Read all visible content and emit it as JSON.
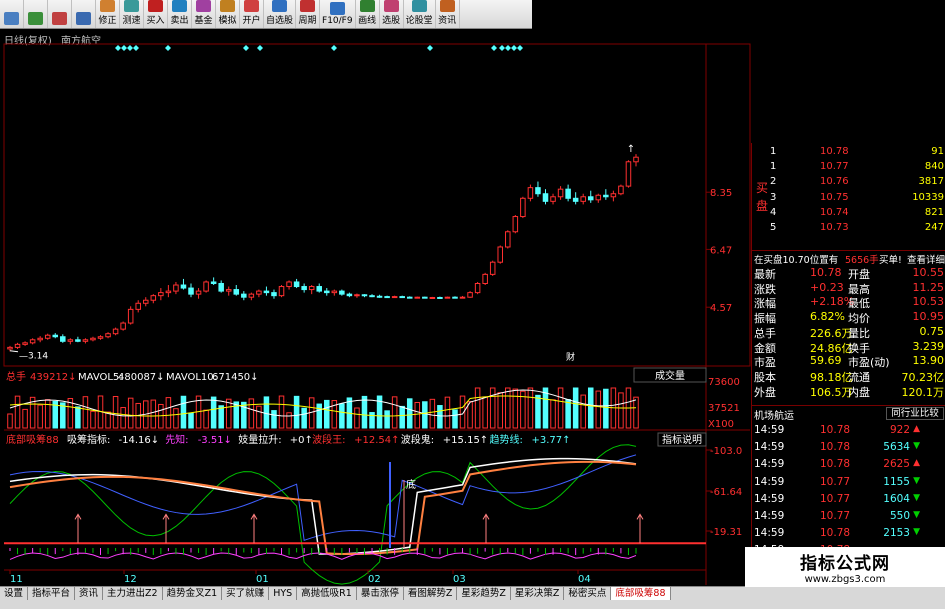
{
  "toolbar": {
    "buttons": [
      {
        "label": "",
        "icon": "app-icon",
        "color": "#4a7fc1"
      },
      {
        "label": "",
        "icon": "grid-icon",
        "color": "#3a8f3a"
      },
      {
        "label": "",
        "icon": "bars-icon",
        "color": "#c04040"
      },
      {
        "label": "",
        "icon": "back-icon",
        "color": "#3a6ab0"
      },
      {
        "label": "修正",
        "icon": "edit-icon",
        "color": "#d08030"
      },
      {
        "label": "测速",
        "icon": "speed-icon",
        "color": "#3a9a9a"
      },
      {
        "label": "买入",
        "icon": "buy-icon",
        "color": "#c02020"
      },
      {
        "label": "卖出",
        "icon": "sell-icon",
        "color": "#2080c0"
      },
      {
        "label": "基金",
        "icon": "fund-icon",
        "color": "#a040a0"
      },
      {
        "label": "模拟",
        "icon": "sim-icon",
        "color": "#c08020"
      },
      {
        "label": "开户",
        "icon": "account-icon",
        "color": "#d04040"
      },
      {
        "label": "自选股",
        "icon": "watchlist-icon",
        "color": "#3070c0"
      },
      {
        "label": "周期",
        "icon": "period-icon",
        "color": "#c03030"
      },
      {
        "label": "F10/F9",
        "icon": "f10-icon",
        "color": "#3070c0"
      },
      {
        "label": "画线",
        "icon": "draw-icon",
        "color": "#308030"
      },
      {
        "label": "选股",
        "icon": "screen-icon",
        "color": "#c04070"
      },
      {
        "label": "论股堂",
        "icon": "forum-icon",
        "color": "#3090a0"
      },
      {
        "label": "资讯",
        "icon": "news-icon",
        "color": "#c06020"
      }
    ]
  },
  "chart": {
    "period": "日线(复权)",
    "name": "南方航空",
    "price_ticks": [
      "8.35",
      "6.47",
      "4.57"
    ],
    "low_label": "3.14",
    "fin_marker": "财",
    "candles": [
      [
        3.2,
        3.3,
        3.12,
        3.25
      ],
      [
        3.25,
        3.4,
        3.2,
        3.35
      ],
      [
        3.35,
        3.45,
        3.3,
        3.4
      ],
      [
        3.4,
        3.55,
        3.35,
        3.5
      ],
      [
        3.5,
        3.62,
        3.42,
        3.55
      ],
      [
        3.55,
        3.7,
        3.5,
        3.65
      ],
      [
        3.65,
        3.72,
        3.55,
        3.6
      ],
      [
        3.6,
        3.68,
        3.4,
        3.45
      ],
      [
        3.45,
        3.55,
        3.35,
        3.5
      ],
      [
        3.5,
        3.6,
        3.42,
        3.45
      ],
      [
        3.45,
        3.55,
        3.38,
        3.5
      ],
      [
        3.5,
        3.6,
        3.45,
        3.55
      ],
      [
        3.55,
        3.65,
        3.5,
        3.6
      ],
      [
        3.6,
        3.75,
        3.55,
        3.7
      ],
      [
        3.7,
        3.9,
        3.65,
        3.85
      ],
      [
        3.85,
        4.1,
        3.8,
        4.05
      ],
      [
        4.05,
        4.6,
        4.0,
        4.5
      ],
      [
        4.5,
        4.8,
        4.4,
        4.7
      ],
      [
        4.7,
        4.9,
        4.6,
        4.8
      ],
      [
        4.8,
        5.0,
        4.7,
        4.95
      ],
      [
        4.95,
        5.2,
        4.8,
        5.05
      ],
      [
        5.05,
        5.3,
        4.9,
        5.1
      ],
      [
        5.1,
        5.4,
        5.0,
        5.3
      ],
      [
        5.3,
        5.5,
        5.15,
        5.2
      ],
      [
        5.2,
        5.35,
        4.9,
        5.0
      ],
      [
        5.0,
        5.2,
        4.85,
        5.1
      ],
      [
        5.1,
        5.45,
        5.05,
        5.4
      ],
      [
        5.4,
        5.55,
        5.3,
        5.35
      ],
      [
        5.35,
        5.45,
        5.05,
        5.1
      ],
      [
        5.1,
        5.25,
        4.95,
        5.15
      ],
      [
        5.15,
        5.3,
        4.95,
        5.0
      ],
      [
        5.0,
        5.1,
        4.8,
        4.9
      ],
      [
        4.9,
        5.05,
        4.8,
        5.0
      ],
      [
        5.0,
        5.15,
        4.9,
        5.1
      ],
      [
        5.1,
        5.25,
        4.95,
        5.05
      ],
      [
        5.05,
        5.15,
        4.85,
        4.95
      ],
      [
        4.95,
        5.3,
        4.9,
        5.25
      ],
      [
        5.25,
        5.45,
        5.15,
        5.4
      ],
      [
        5.4,
        5.5,
        5.2,
        5.25
      ],
      [
        5.25,
        5.35,
        5.05,
        5.15
      ],
      [
        5.15,
        5.3,
        5.0,
        5.25
      ],
      [
        5.25,
        5.35,
        5.05,
        5.1
      ],
      [
        5.1,
        5.2,
        4.95,
        5.05
      ],
      [
        5.05,
        5.15,
        4.95,
        5.1
      ],
      [
        5.1,
        5.15,
        4.95,
        5.0
      ],
      [
        5.0,
        5.05,
        4.9,
        4.95
      ],
      [
        4.95,
        5.02,
        4.88,
        4.98
      ],
      [
        4.98,
        5.0,
        4.9,
        4.95
      ],
      [
        4.95,
        5.0,
        4.9,
        4.93
      ],
      [
        4.93,
        4.98,
        4.88,
        4.92
      ],
      [
        4.92,
        4.95,
        4.88,
        4.9
      ],
      [
        4.9,
        4.95,
        4.88,
        4.92
      ],
      [
        4.92,
        4.95,
        4.88,
        4.9
      ],
      [
        4.9,
        4.93,
        4.87,
        4.89
      ],
      [
        4.89,
        4.92,
        4.86,
        4.9
      ],
      [
        4.9,
        4.92,
        4.86,
        4.88
      ],
      [
        4.88,
        4.91,
        4.86,
        4.89
      ],
      [
        4.89,
        4.92,
        4.86,
        4.88
      ],
      [
        4.88,
        4.92,
        4.86,
        4.9
      ],
      [
        4.9,
        4.93,
        4.87,
        4.89
      ],
      [
        4.89,
        4.94,
        4.86,
        4.9
      ],
      [
        4.9,
        5.1,
        4.88,
        5.05
      ],
      [
        5.05,
        5.4,
        5.0,
        5.35
      ],
      [
        5.35,
        5.7,
        5.3,
        5.65
      ],
      [
        5.65,
        6.1,
        5.6,
        6.05
      ],
      [
        6.05,
        6.6,
        6.0,
        6.55
      ],
      [
        6.55,
        7.1,
        6.5,
        7.05
      ],
      [
        7.05,
        7.6,
        7.0,
        7.55
      ],
      [
        7.55,
        8.2,
        7.5,
        8.15
      ],
      [
        8.15,
        8.6,
        8.05,
        8.5
      ],
      [
        8.5,
        8.7,
        8.2,
        8.3
      ],
      [
        8.3,
        8.45,
        7.95,
        8.05
      ],
      [
        8.05,
        8.3,
        7.95,
        8.2
      ],
      [
        8.2,
        8.55,
        8.1,
        8.45
      ],
      [
        8.45,
        8.6,
        8.05,
        8.15
      ],
      [
        8.15,
        8.35,
        7.95,
        8.05
      ],
      [
        8.05,
        8.3,
        7.95,
        8.2
      ],
      [
        8.2,
        8.4,
        8.0,
        8.1
      ],
      [
        8.1,
        8.3,
        8.0,
        8.25
      ],
      [
        8.25,
        8.45,
        8.1,
        8.2
      ],
      [
        8.2,
        8.4,
        8.05,
        8.3
      ],
      [
        8.3,
        8.6,
        8.25,
        8.55
      ],
      [
        8.55,
        9.4,
        8.5,
        9.35
      ],
      [
        9.35,
        9.6,
        9.2,
        9.5
      ]
    ]
  },
  "volume": {
    "label": "总手",
    "value": "439212",
    "ma5_label": "MAVOL5:",
    "ma5_value": "480087",
    "ma10_label": "MAVOL10:",
    "ma10_value": "671450",
    "dropdown": "成交量",
    "axis_ticks": [
      "73600",
      "37521",
      "X100"
    ]
  },
  "indicator": {
    "name": "底部吸筹88",
    "label1": "吸筹指标:",
    "value1": "-14.16",
    "label2": "先知:",
    "value2": "-3.51",
    "label3": "妓量拉升:",
    "value3": "+0",
    "label4": "波段王:",
    "value4": "+12.54",
    "label5": "波段鬼:",
    "value5": "+15.15",
    "label6": "趋势线:",
    "value6": "+3.77",
    "help_button": "指标说明",
    "axis_ticks": [
      "103.0",
      "61.64",
      "19.31"
    ],
    "marker_text": "底",
    "date_ticks": [
      "11",
      "12",
      "01",
      "02",
      "03",
      "04"
    ]
  },
  "orderbook": {
    "side_label_top": "买",
    "side_label_bottom": "盘",
    "levels": [
      {
        "idx": "1",
        "price": "10.78",
        "vol": "91"
      },
      {
        "idx": "1",
        "price": "10.77",
        "vol": "840"
      },
      {
        "idx": "2",
        "price": "10.76",
        "vol": "3817"
      },
      {
        "idx": "3",
        "price": "10.75",
        "vol": "10339"
      },
      {
        "idx": "4",
        "price": "10.74",
        "vol": "821"
      },
      {
        "idx": "5",
        "price": "10.73",
        "vol": "247"
      }
    ],
    "info_text": "在买盘10.70位置有",
    "info_value": "5656手",
    "info_action": "买单!",
    "info_link": "查看详细"
  },
  "quote": {
    "rows": [
      {
        "l1": "最新",
        "v1": "10.78",
        "l2": "开盘",
        "v2": "10.55"
      },
      {
        "l1": "涨跌",
        "v1": "+0.23",
        "l2": "最高",
        "v2": "11.25"
      },
      {
        "l1": "涨幅",
        "v1": "+2.18%",
        "l2": "最低",
        "v2": "10.53"
      },
      {
        "l1": "振幅",
        "v1": "6.82%",
        "l2": "均价",
        "v2": "10.95"
      },
      {
        "l1": "总手",
        "v1": "226.6万",
        "l2": "量比",
        "v2": "0.75"
      },
      {
        "l1": "金额",
        "v1": "24.86亿",
        "l2": "换手",
        "v2": "3.239"
      },
      {
        "l1": "市盈",
        "v1": "59.69",
        "l2": "市盈(动)",
        "v2": "13.90"
      },
      {
        "l1": "股本",
        "v1": "98.18亿",
        "l2": "流通",
        "v2": "70.23亿"
      },
      {
        "l1": "外盘",
        "v1": "106.5万",
        "l2": "内盘",
        "v2": "120.1万"
      }
    ]
  },
  "sector": {
    "label": "机场航运",
    "compare_button": "同行业比较"
  },
  "ticks": [
    {
      "time": "14:59",
      "price": "10.78",
      "vol": "922",
      "dir": "up"
    },
    {
      "time": "14:59",
      "price": "10.78",
      "vol": "5634",
      "dir": "down"
    },
    {
      "time": "14:59",
      "price": "10.78",
      "vol": "2625",
      "dir": "up"
    },
    {
      "time": "14:59",
      "price": "10.77",
      "vol": "1155",
      "dir": "down"
    },
    {
      "time": "14:59",
      "price": "10.77",
      "vol": "1604",
      "dir": "down"
    },
    {
      "time": "14:59",
      "price": "10.77",
      "vol": "550",
      "dir": "down"
    },
    {
      "time": "14:59",
      "price": "10.78",
      "vol": "2153",
      "dir": "down"
    },
    {
      "time": "14:59",
      "price": "10.78",
      "vol": "",
      "dir": ""
    }
  ],
  "tabs": [
    {
      "label": "设置",
      "active": false
    },
    {
      "label": "指标平台",
      "active": false
    },
    {
      "label": "资讯",
      "active": false
    },
    {
      "label": "主力进出Z2",
      "active": false
    },
    {
      "label": "趋势金叉Z1",
      "active": false
    },
    {
      "label": "买了就赚",
      "active": false
    },
    {
      "label": "HYS",
      "active": false
    },
    {
      "label": "高抛低吸R1",
      "active": false
    },
    {
      "label": "暴击涨停",
      "active": false
    },
    {
      "label": "看图解势Z",
      "active": false
    },
    {
      "label": "星彩趋势Z",
      "active": false
    },
    {
      "label": "星彩决策Z",
      "active": false
    },
    {
      "label": "秘密买点",
      "active": false
    },
    {
      "label": "底部吸筹88",
      "active": true
    }
  ],
  "watermark": {
    "title": "指标公式网",
    "url": "www.zbgs3.com"
  },
  "colors": {
    "up": "#ff3030",
    "down": "#54ffff",
    "grid": "#800000",
    "yellow": "#ffff00",
    "green": "#00c000",
    "cyan": "#54ffff",
    "magenta": "#ff40ff",
    "blue": "#4060ff",
    "white": "#ffffff"
  }
}
